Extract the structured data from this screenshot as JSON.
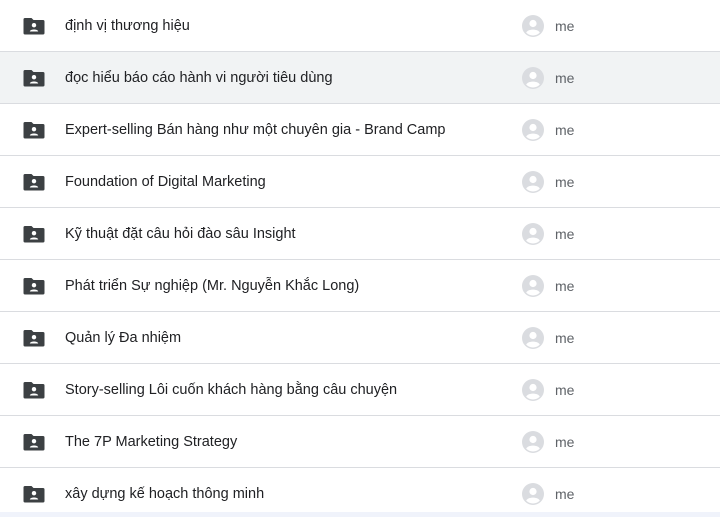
{
  "files": [
    {
      "name": "định vị thương hiệu",
      "owner": "me",
      "icon": "folder-icon",
      "hover": false
    },
    {
      "name": "đọc hiểu báo cáo hành vi người tiêu dùng",
      "owner": "me",
      "icon": "folder-icon",
      "hover": true
    },
    {
      "name": "Expert-selling Bán hàng như một chuyên gia - Brand Camp",
      "owner": "me",
      "icon": "folder-icon",
      "hover": false
    },
    {
      "name": "Foundation of Digital Marketing",
      "owner": "me",
      "icon": "folder-icon",
      "hover": false
    },
    {
      "name": "Kỹ thuật đặt câu hỏi đào sâu Insight",
      "owner": "me",
      "icon": "folder-icon",
      "hover": false
    },
    {
      "name": "Phát triển Sự nghiệp (Mr. Nguyễn Khắc Long)",
      "owner": "me",
      "icon": "folder-icon",
      "hover": false
    },
    {
      "name": "Quản lý Đa nhiệm",
      "owner": "me",
      "icon": "folder-icon",
      "hover": false
    },
    {
      "name": "Story-selling Lôi cuốn khách hàng bằng câu chuyện",
      "owner": "me",
      "icon": "folder-icon",
      "hover": false
    },
    {
      "name": "The 7P Marketing Strategy",
      "owner": "me",
      "icon": "folder-icon",
      "hover": false
    },
    {
      "name": "xây dựng kế hoạch thông minh",
      "owner": "me",
      "icon": "folder-icon",
      "hover": false
    }
  ],
  "colors": {
    "folder_icon": "#3c4043",
    "avatar_bg": "#dadce0",
    "avatar_fg": "#ffffff",
    "row_hover": "#f1f3f4",
    "divider": "#dadce0"
  }
}
